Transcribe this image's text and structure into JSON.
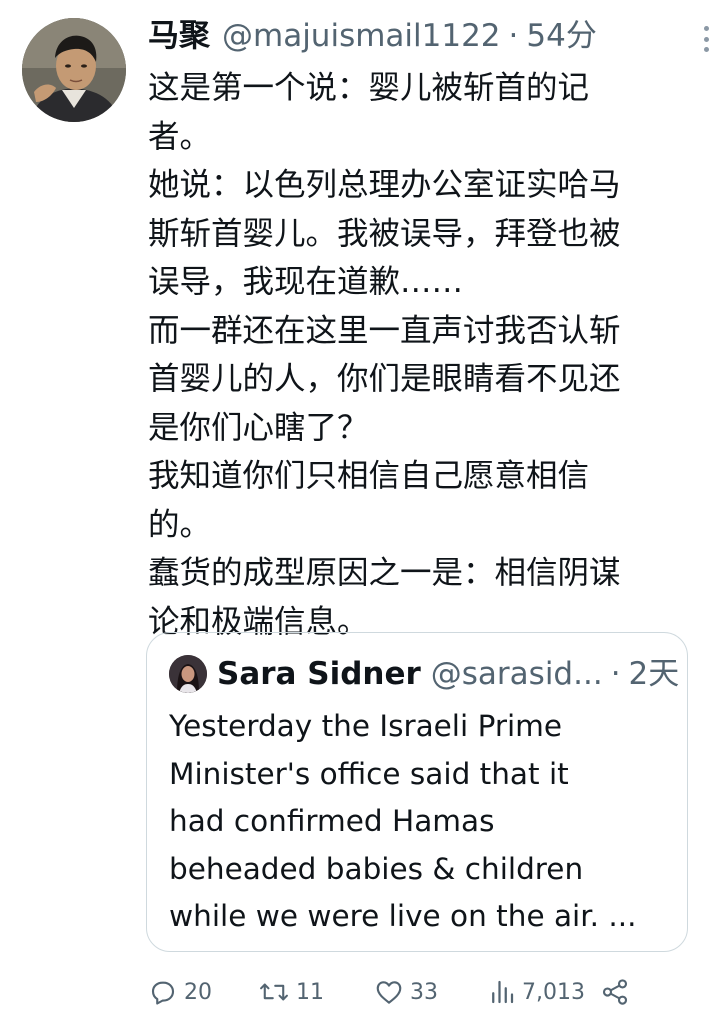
{
  "tweet": {
    "author_name": "马聚",
    "handle": "@majuismail1122",
    "separator": "·",
    "time": "54分",
    "body_lines": [
      "这是第一个说：婴儿被斩首的记",
      "者。",
      "她说：以色列总理办公室证实哈马",
      "斯斩首婴儿。我被误导，拜登也被",
      "误导，我现在道歉……",
      "而一群还在这里一直声讨我否认斩",
      "首婴儿的人，你们是眼睛看不见还",
      "是你们心瞎了？",
      "我知道你们只相信自己愿意相信",
      "的。",
      "蠢货的成型原因之一是：相信阴谋",
      "论和极端信息。"
    ]
  },
  "quote": {
    "author_name": "Sara Sidner",
    "handle": "@sarasid...",
    "separator": "·",
    "time": "2天",
    "body_lines": [
      "Yesterday the Israeli Prime",
      "Minister's office said that it",
      "had confirmed Hamas",
      "beheaded babies & children",
      "while we were live on the air. ..."
    ]
  },
  "actions": {
    "replies": "20",
    "retweets": "11",
    "likes": "33",
    "views": "7,013"
  },
  "icons": {
    "more": "more-vertical-icon",
    "reply": "reply-icon",
    "retweet": "retweet-icon",
    "like": "heart-icon",
    "views": "views-chart-icon",
    "share": "share-icon"
  },
  "colors": {
    "text_primary": "#0f1419",
    "text_secondary": "#536471",
    "border": "#cfd9de"
  }
}
